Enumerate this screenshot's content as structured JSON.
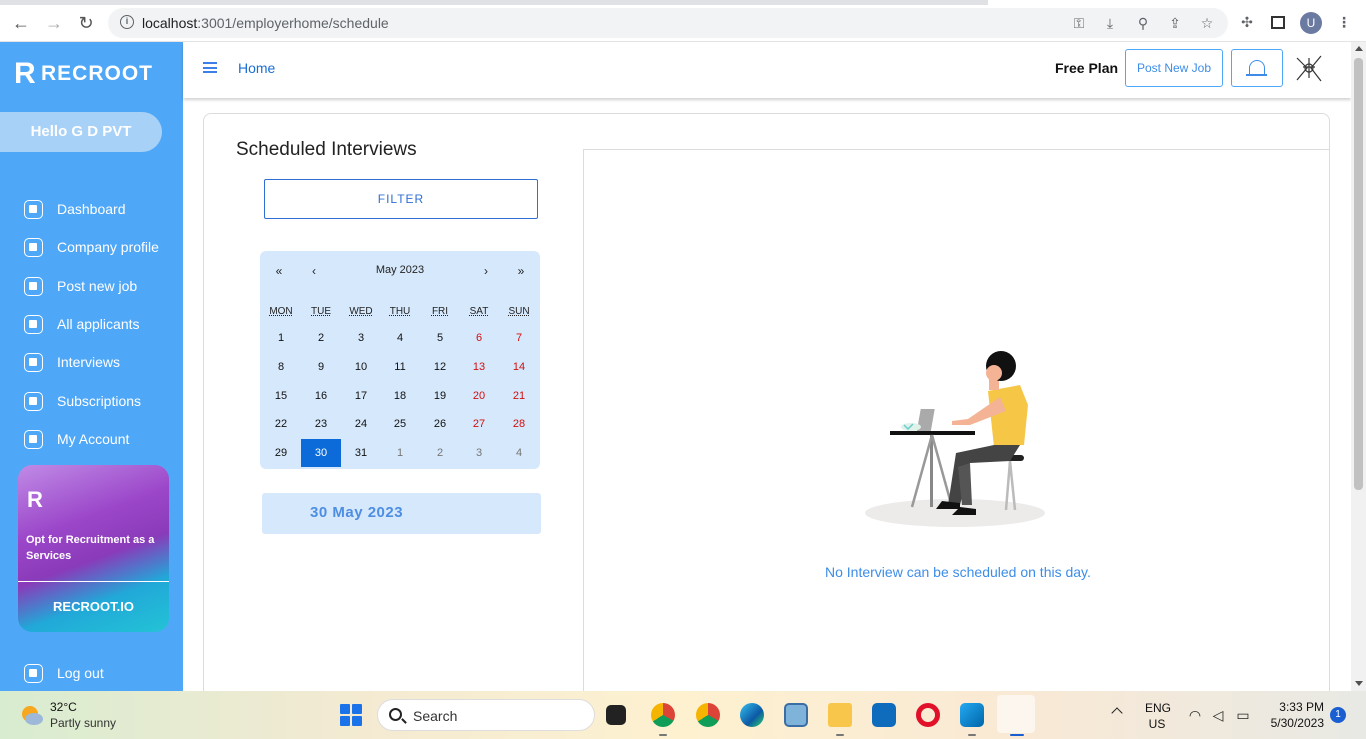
{
  "browser": {
    "url_host": "localhost",
    "url_path": ":3001/employerhome/schedule"
  },
  "profile": {
    "initial": "U"
  },
  "sidebar": {
    "brand": "RECROOT",
    "greeting": "Hello G D PVT",
    "items": [
      {
        "label": "Dashboard",
        "icon": "dashboard-icon"
      },
      {
        "label": "Company profile",
        "icon": "company-icon"
      },
      {
        "label": "Post new job",
        "icon": "post-job-icon"
      },
      {
        "label": "All applicants",
        "icon": "applicants-icon"
      },
      {
        "label": "Interviews",
        "icon": "interviews-icon"
      },
      {
        "label": "Subscriptions",
        "icon": "subscriptions-icon"
      },
      {
        "label": "My Account",
        "icon": "account-icon"
      }
    ],
    "promo": {
      "text": "Opt for Recruitment as a Services",
      "site": "RECROOT.IO"
    },
    "logout": "Log out"
  },
  "header": {
    "home": "Home",
    "plan": "Free Plan",
    "post_job": "Post New Job"
  },
  "main": {
    "title": "Scheduled Interviews",
    "filter": "FILTER",
    "calendar": {
      "prev_year": "«",
      "prev_month": "‹",
      "month": "May 2023",
      "next_month": "›",
      "next_year": "»",
      "weekdays": [
        "MON",
        "TUE",
        "WED",
        "THU",
        "FRI",
        "SAT",
        "SUN"
      ],
      "weeks": [
        [
          "1",
          "2",
          "3",
          "4",
          "5",
          "6",
          "7"
        ],
        [
          "8",
          "9",
          "10",
          "11",
          "12",
          "13",
          "14"
        ],
        [
          "15",
          "16",
          "17",
          "18",
          "19",
          "20",
          "21"
        ],
        [
          "22",
          "23",
          "24",
          "25",
          "26",
          "27",
          "28"
        ],
        [
          "29",
          "30",
          "31",
          "1",
          "2",
          "3",
          "4"
        ]
      ],
      "selected_day": "30"
    },
    "selected_date": "30 May 2023",
    "empty_message": "No Interview can be scheduled on this day."
  },
  "taskbar": {
    "temperature": "32°C",
    "weather": "Partly sunny",
    "search": "Search",
    "lang_1": "ENG",
    "lang_2": "US",
    "time": "3:33 PM",
    "date": "5/30/2023",
    "notifications": "1"
  },
  "colors": {
    "sidebar": "#4fa7f7",
    "accent": "#3d8de8",
    "selected_day": "#0c6bd9",
    "weekend": "#d21010",
    "calendar_bg": "#d6e8fb"
  }
}
